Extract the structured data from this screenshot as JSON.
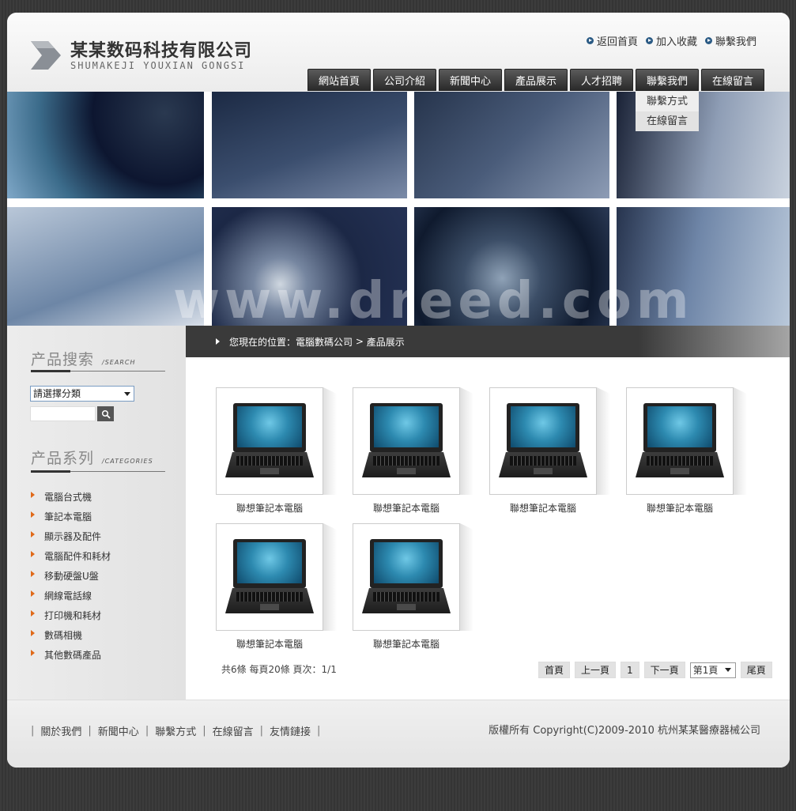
{
  "header": {
    "logo_cn": "某某数码科技有限公司",
    "logo_en": "SHUMAKEJI YOUXIAN GONGSI",
    "top_links": [
      "返回首頁",
      "加入收藏",
      "聯繫我們"
    ]
  },
  "nav": {
    "items": [
      "網站首頁",
      "公司介紹",
      "新聞中心",
      "產品展示",
      "人才招聘",
      "聯繫我們",
      "在線留言"
    ],
    "submenu": [
      "聯繫方式",
      "在線留言"
    ]
  },
  "banner": {
    "watermark": "www.dreed.com"
  },
  "sidebar": {
    "search_title_cn": "产品搜索",
    "search_title_en": "/SEARCH",
    "category_select": "請選擇分類",
    "series_title_cn": "产品系列",
    "series_title_en": "/CATEGORIES",
    "categories": [
      "電腦台式機",
      "筆記本電腦",
      "顯示器及配件",
      "電腦配件和耗材",
      "移動硬盤U盤",
      "網線電話線",
      "打印機和耗材",
      "數碼相機",
      "其他數碼產品"
    ]
  },
  "breadcrumb": {
    "prefix": "您現在的位置：",
    "site": "電腦數碼公司",
    "sep": " > ",
    "current": "產品展示"
  },
  "products": [
    {
      "name": "聯想筆記本電腦"
    },
    {
      "name": "聯想筆記本電腦"
    },
    {
      "name": "聯想筆記本電腦"
    },
    {
      "name": "聯想筆記本電腦"
    },
    {
      "name": "聯想筆記本電腦"
    },
    {
      "name": "聯想筆記本電腦"
    }
  ],
  "pagination": {
    "info": "共6條 每頁20條 頁次：1/1",
    "first": "首頁",
    "prev": "上一頁",
    "current": "1",
    "next": "下一頁",
    "select_value": "第1頁",
    "last": "尾頁"
  },
  "footer": {
    "links": [
      "關於我們",
      "新聞中心",
      "聯繫方式",
      "在線留言",
      "友情鏈接"
    ],
    "separator": "|",
    "copyright": "版權所有 Copyright(C)2009-2010 杭州某某醫療器械公司"
  }
}
